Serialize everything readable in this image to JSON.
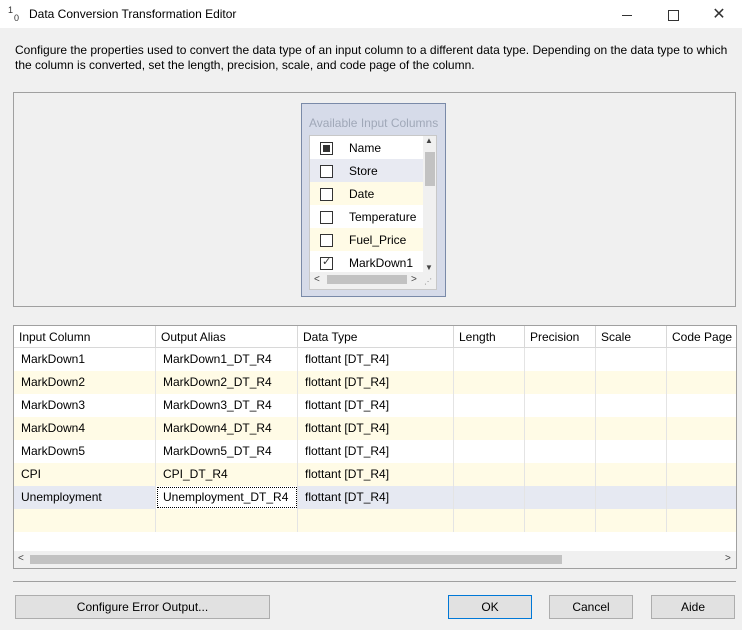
{
  "window": {
    "title": "Data Conversion Transformation Editor",
    "icon": "data-conversion-icon",
    "icon_glyph_top": "1",
    "icon_glyph_bottom": "0"
  },
  "description": "Configure the properties used to convert the data type of an input column to a different data type. Depending on the data type to which the column is converted, set the length, precision, scale, and code page of the column.",
  "available": {
    "header": "Available Input Columns",
    "items": [
      {
        "label": "Name",
        "state": "indeterminate"
      },
      {
        "label": "Store",
        "state": "unchecked"
      },
      {
        "label": "Date",
        "state": "unchecked"
      },
      {
        "label": "Temperature",
        "state": "unchecked"
      },
      {
        "label": "Fuel_Price",
        "state": "unchecked"
      },
      {
        "label": "MarkDown1",
        "state": "checked"
      }
    ]
  },
  "grid": {
    "columns": [
      "Input Column",
      "Output Alias",
      "Data Type",
      "Length",
      "Precision",
      "Scale",
      "Code Page"
    ],
    "rows": [
      [
        "MarkDown1",
        "MarkDown1_DT_R4",
        "flottant [DT_R4]",
        "",
        "",
        "",
        ""
      ],
      [
        "MarkDown2",
        "MarkDown2_DT_R4",
        "flottant [DT_R4]",
        "",
        "",
        "",
        ""
      ],
      [
        "MarkDown3",
        "MarkDown3_DT_R4",
        "flottant [DT_R4]",
        "",
        "",
        "",
        ""
      ],
      [
        "MarkDown4",
        "MarkDown4_DT_R4",
        "flottant [DT_R4]",
        "",
        "",
        "",
        ""
      ],
      [
        "MarkDown5",
        "MarkDown5_DT_R4",
        "flottant [DT_R4]",
        "",
        "",
        "",
        ""
      ],
      [
        "CPI",
        "CPI_DT_R4",
        "flottant [DT_R4]",
        "",
        "",
        "",
        ""
      ],
      [
        "Unemployment",
        "Unemployment_DT_R4",
        "flottant [DT_R4]",
        "",
        "",
        "",
        ""
      ]
    ]
  },
  "buttons": {
    "configure_error": "Configure Error Output...",
    "ok": "OK",
    "cancel": "Cancel",
    "help": "Aide"
  },
  "colors": {
    "accent": "#0078d7",
    "alt_row": "#fffbe6",
    "selected_row": "#e6e9f2",
    "panel_header_bg": "#d6dbe9"
  }
}
